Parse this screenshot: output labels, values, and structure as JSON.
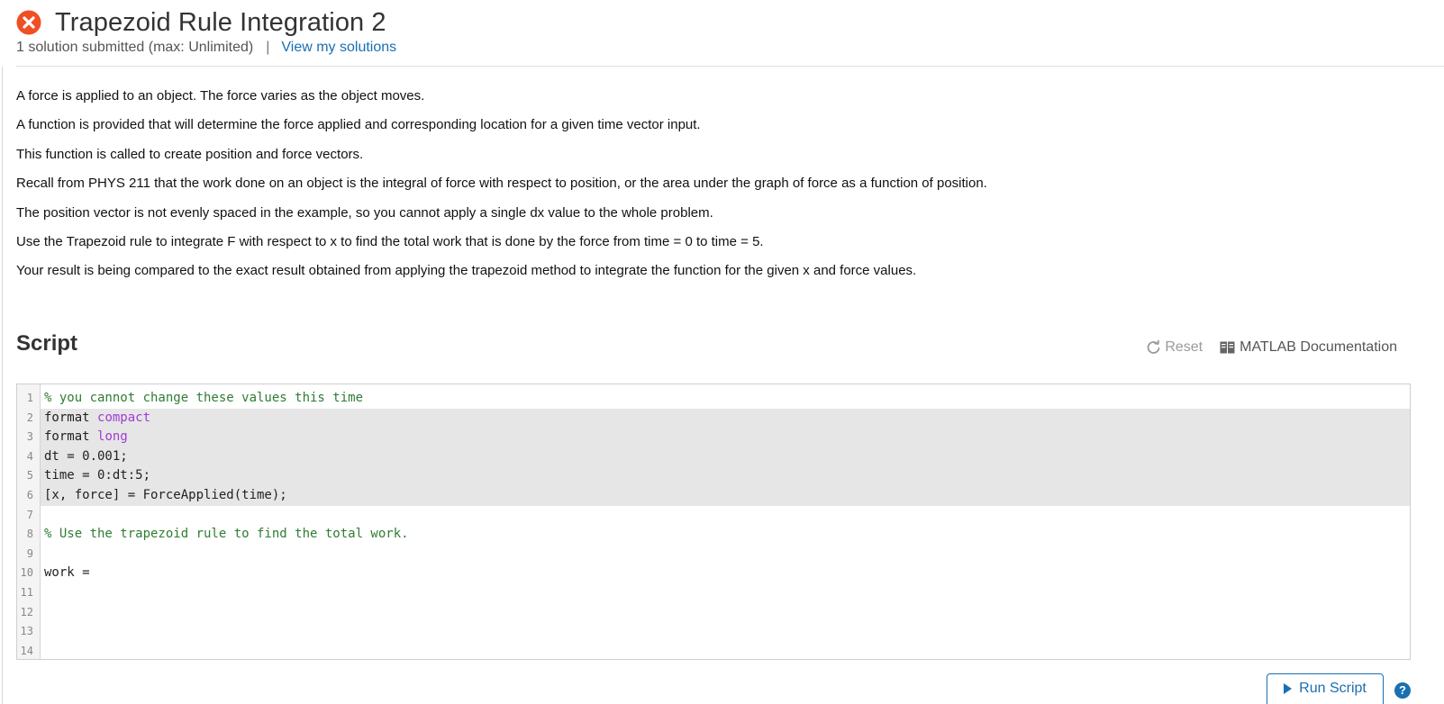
{
  "header": {
    "title": "Trapezoid Rule Integration 2",
    "submissions": "1 solution submitted (max: Unlimited)",
    "separator": "|",
    "view_solutions": "View my solutions",
    "status_color": "#f04e23"
  },
  "description": [
    "A force is applied to an object. The force varies as the object moves.",
    "A function is provided that will determine the force applied and corresponding location for a given time vector input.",
    "This function is called to create position and force vectors.",
    "Recall from PHYS 211 that the work done on an object is the integral of force with respect to position, or the area under the graph of force as a function of position.",
    "The position vector is not evenly spaced in the example, so you cannot apply a single dx value to the whole problem.",
    "Use the Trapezoid rule to integrate F with respect to x to find the total work that is done by the force from time = 0 to time = 5.",
    "Your result is being compared to the exact result obtained from applying the trapezoid method to integrate the function for the given x and force values."
  ],
  "script": {
    "heading": "Script",
    "reset_label": "Reset",
    "docs_label": "MATLAB Documentation",
    "run_label": "Run Script",
    "lines": [
      {
        "num": "1",
        "locked": false,
        "tokens": [
          {
            "t": "% you cannot change these values this time",
            "k": "comment"
          }
        ]
      },
      {
        "num": "2",
        "locked": true,
        "tokens": [
          {
            "t": "format ",
            "k": "plain"
          },
          {
            "t": "compact",
            "k": "keyword"
          }
        ]
      },
      {
        "num": "3",
        "locked": true,
        "tokens": [
          {
            "t": "format ",
            "k": "plain"
          },
          {
            "t": "long",
            "k": "keyword"
          }
        ]
      },
      {
        "num": "4",
        "locked": true,
        "tokens": [
          {
            "t": "dt = 0.001;",
            "k": "plain"
          }
        ]
      },
      {
        "num": "5",
        "locked": true,
        "tokens": [
          {
            "t": "time = 0:dt:5;",
            "k": "plain"
          }
        ]
      },
      {
        "num": "6",
        "locked": true,
        "tokens": [
          {
            "t": "[x, force] = ForceApplied(time);",
            "k": "plain"
          }
        ]
      },
      {
        "num": "7",
        "locked": false,
        "tokens": []
      },
      {
        "num": "8",
        "locked": false,
        "tokens": [
          {
            "t": "% Use the trapezoid rule to find the total work.",
            "k": "comment"
          }
        ]
      },
      {
        "num": "9",
        "locked": false,
        "tokens": []
      },
      {
        "num": "10",
        "locked": false,
        "tokens": [
          {
            "t": "work = ",
            "k": "plain"
          }
        ]
      },
      {
        "num": "11",
        "locked": false,
        "tokens": []
      },
      {
        "num": "12",
        "locked": false,
        "tokens": []
      },
      {
        "num": "13",
        "locked": false,
        "tokens": []
      },
      {
        "num": "14",
        "locked": false,
        "tokens": []
      }
    ]
  }
}
